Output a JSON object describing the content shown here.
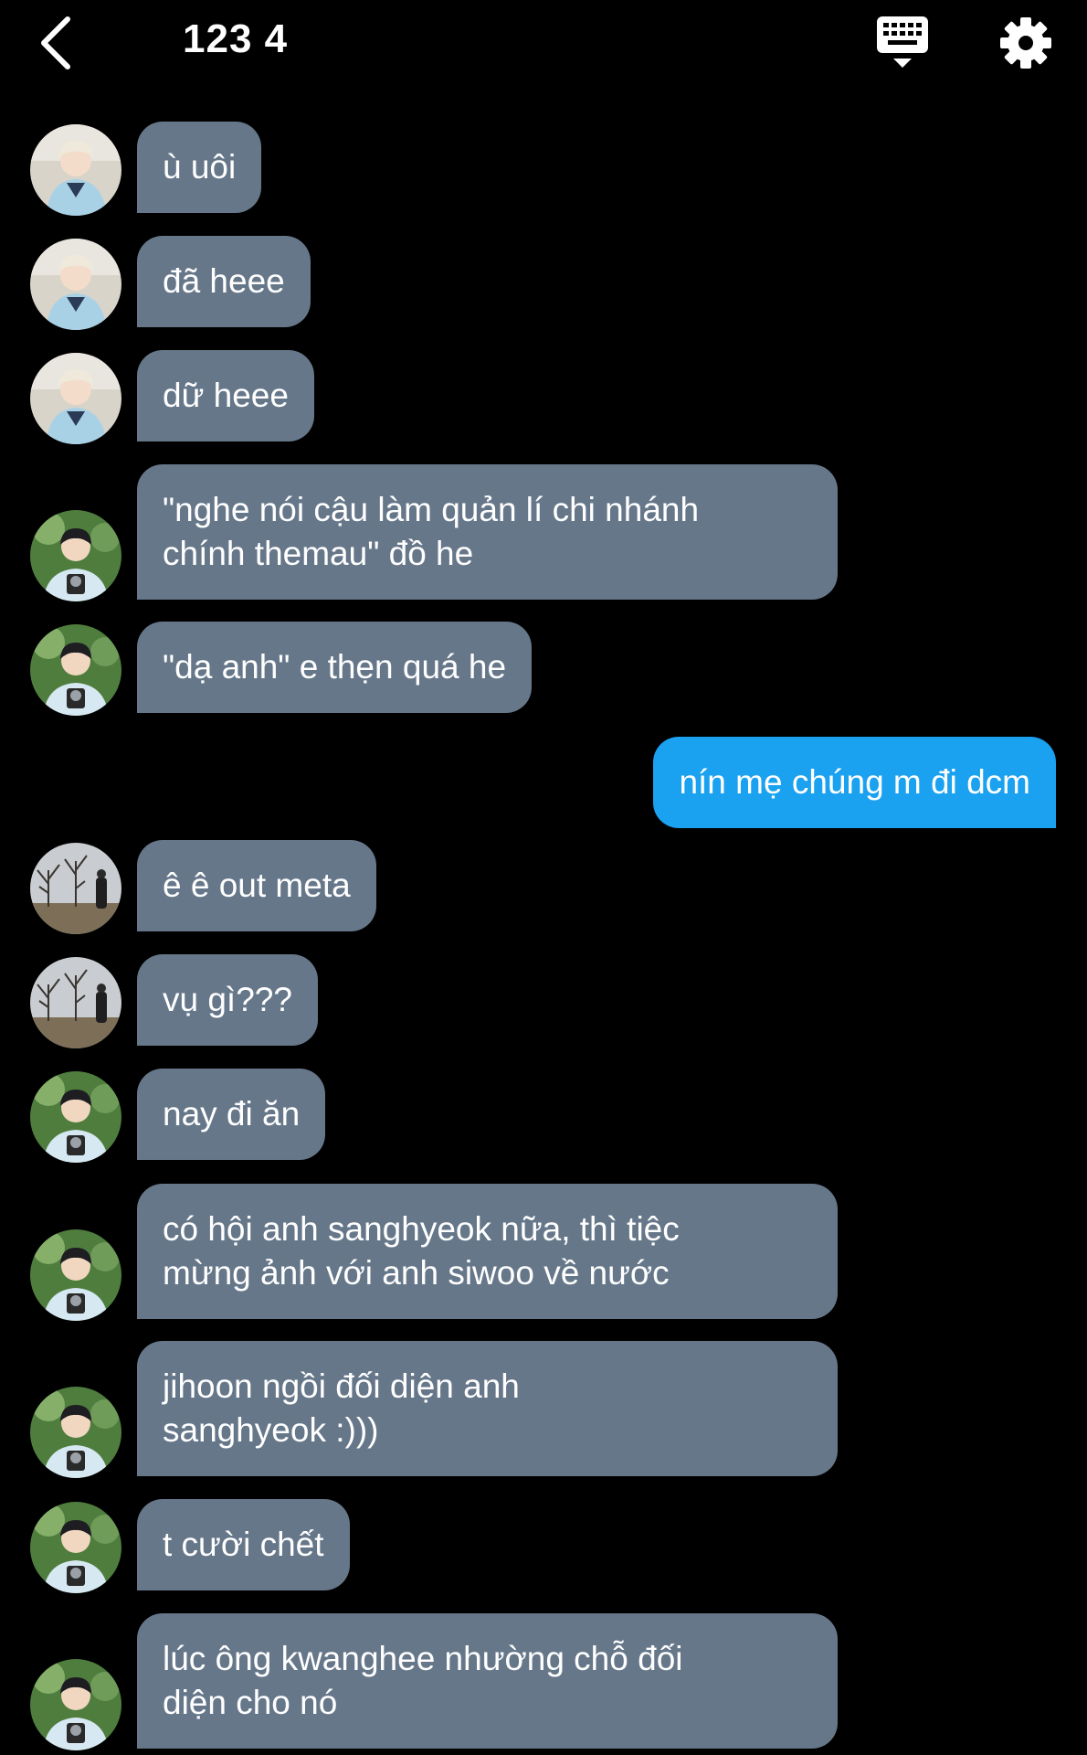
{
  "header": {
    "title": "123 4"
  },
  "icons": {
    "back": "chevron-left-icon",
    "keyboard": "keyboard-icon",
    "settings": "gear-icon"
  },
  "colors": {
    "background": "#000000",
    "incoming_bubble": "#66778a",
    "outgoing_bubble": "#1aa1f0"
  },
  "messages": [
    {
      "text": "ù uôi",
      "sender": "light-hair"
    },
    {
      "text": "đã heee",
      "sender": "light-hair"
    },
    {
      "text": "dữ heee",
      "sender": "light-hair"
    },
    {
      "text": "\"nghe nói cậu làm quản lí chi nhánh\nchính themau\" đồ he",
      "sender": "camera"
    },
    {
      "text": "\"dạ anh\" e thẹn quá he",
      "sender": "camera"
    },
    {
      "text": "nín mẹ chúng m đi dcm",
      "sender": "me"
    },
    {
      "text": "ê ê out meta",
      "sender": "trees"
    },
    {
      "text": "vụ gì???",
      "sender": "trees"
    },
    {
      "text": "nay đi ăn",
      "sender": "camera"
    },
    {
      "text": "có hội anh sanghyeok nữa, thì tiệc\nmừng ảnh với anh siwoo về nước",
      "sender": "camera"
    },
    {
      "text": "jihoon ngồi đối diện anh\nsanghyeok :)))",
      "sender": "camera"
    },
    {
      "text": "t cười chết",
      "sender": "camera"
    },
    {
      "text": "lúc ông kwanghee nhường chỗ đối\ndiện cho nó",
      "sender": "camera"
    }
  ]
}
